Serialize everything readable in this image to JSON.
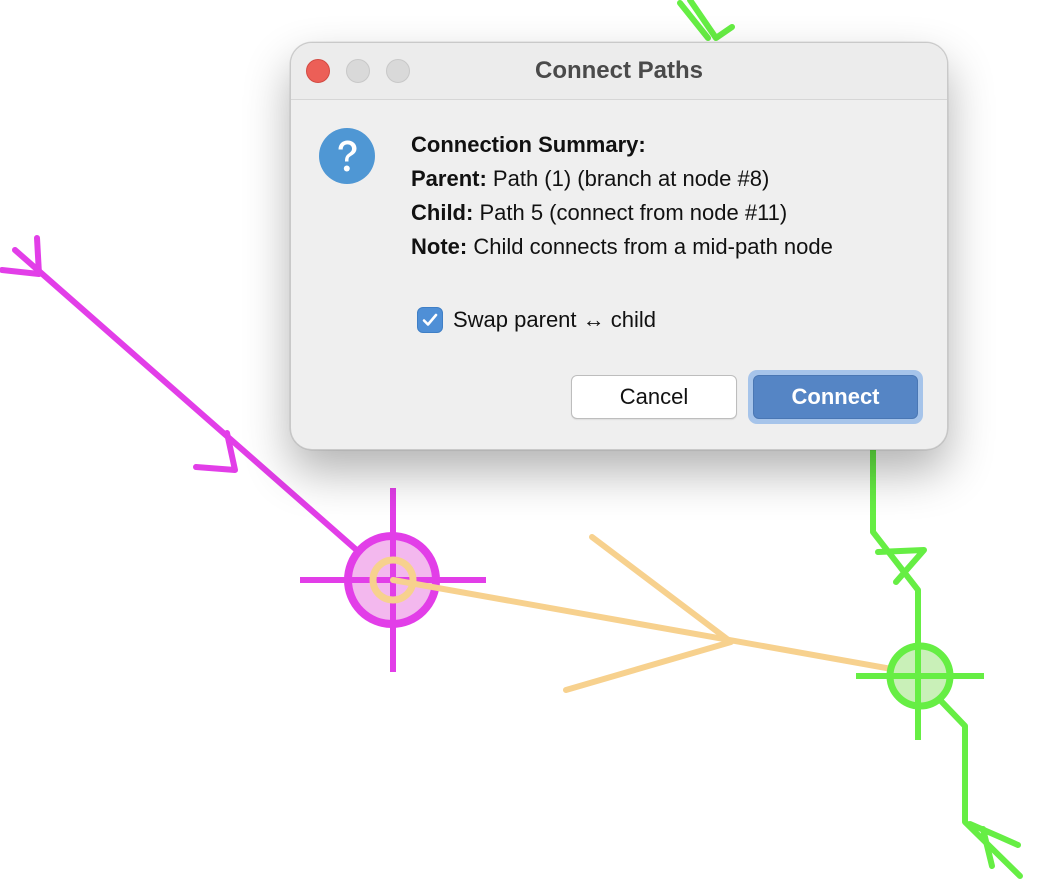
{
  "dialog": {
    "title": "Connect Paths",
    "icon": "question-icon",
    "summary_heading": "Connection Summary:",
    "parent_label": "Parent:",
    "parent_value": "Path (1) (branch at node #8)",
    "child_label": "Child:",
    "child_value": "Path 5 (connect from node #11)",
    "note_label": "Note:",
    "note_value": "Child connects from a mid-path node",
    "swap_label": "Swap parent ↔ child",
    "swap_checked": true,
    "cancel_label": "Cancel",
    "connect_label": "Connect"
  },
  "colors": {
    "magenta_path": "#e23ee8",
    "orange_path": "#f7d18e",
    "green_path": "#66ee44",
    "accent_blue": "#5585c5",
    "help_icon_blue": "#4f97d4"
  }
}
